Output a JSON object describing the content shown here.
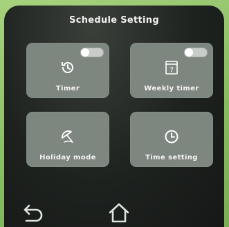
{
  "header": {
    "title": "Schedule Setting"
  },
  "tiles": [
    {
      "label": "Timer",
      "toggle_on": false,
      "icon": "timer-history-icon"
    },
    {
      "label": "Weekly timer",
      "toggle_on": false,
      "icon": "calendar-icon",
      "icon_text": "7"
    },
    {
      "label": "Holiday mode",
      "icon": "beach-umbrella-icon"
    },
    {
      "label": "Time setting",
      "icon": "clock-icon"
    }
  ],
  "nav": {
    "back_icon": "back-arrow-icon",
    "home_icon": "home-icon"
  },
  "colors": {
    "accent": "#8fc46a",
    "tile": "#7e8680",
    "text": "#f2f2f2"
  }
}
